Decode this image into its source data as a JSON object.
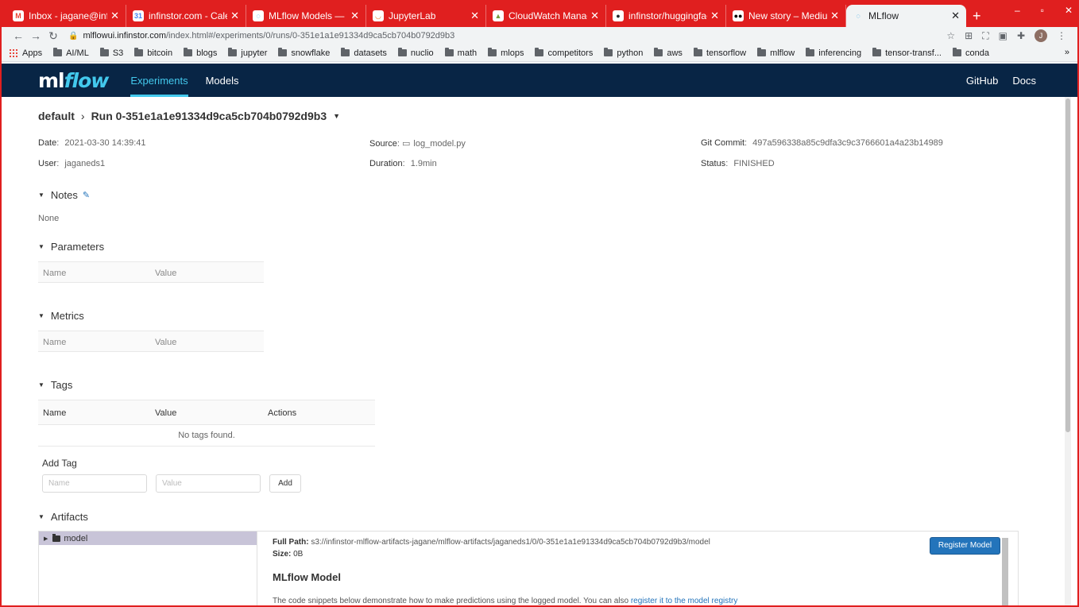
{
  "browser": {
    "tabs": [
      {
        "title": "Inbox - jagane@infinst",
        "icon": "gmail-icon",
        "color": "#ea4335",
        "glyph": "M"
      },
      {
        "title": "infinstor.com - Calendar",
        "icon": "calendar-icon",
        "color": "#4285f4",
        "glyph": "31"
      },
      {
        "title": "MLflow Models — MLflow",
        "icon": "mlflow-icon",
        "color": "#0194e2",
        "glyph": "◌"
      },
      {
        "title": "JupyterLab",
        "icon": "jupyter-icon",
        "color": "#f37726",
        "glyph": "◡"
      },
      {
        "title": "CloudWatch Management",
        "icon": "cloudwatch-icon",
        "color": "#759c3e",
        "glyph": "▲"
      },
      {
        "title": "infinstor/huggingface",
        "icon": "github-icon",
        "color": "#24292e",
        "glyph": "●"
      },
      {
        "title": "New story – Medium",
        "icon": "medium-icon",
        "color": "#000000",
        "glyph": "●●"
      },
      {
        "title": "MLflow",
        "icon": "mlflow-icon",
        "color": "#0194e2",
        "glyph": "◌"
      }
    ],
    "active_tab": 7,
    "url_host": "mlflowui.infinstor.com",
    "url_path": "/index.html#/experiments/0/runs/0-351e1a1e91334d9ca5cb704b0792d9b3",
    "profile_initial": "J",
    "bookmarks": [
      "Apps",
      "AI/ML",
      "S3",
      "bitcoin",
      "blogs",
      "jupyter",
      "snowflake",
      "datasets",
      "nuclio",
      "math",
      "mlops",
      "competitors",
      "python",
      "aws",
      "tensorflow",
      "mlflow",
      "inferencing",
      "tensor-transf...",
      "conda"
    ],
    "bookmarks_more": "»"
  },
  "header": {
    "logo_ml": "ml",
    "logo_flow": "flow",
    "nav": [
      "Experiments",
      "Models"
    ],
    "active_nav": 0,
    "right_links": [
      "GitHub",
      "Docs"
    ]
  },
  "run": {
    "experiment": "default",
    "run_name": "Run 0-351e1a1e91334d9ca5cb704b0792d9b3",
    "meta": {
      "date_label": "Date",
      "date": "2021-03-30 14:39:41",
      "source_label": "Source",
      "source": "log_model.py",
      "git_label": "Git Commit",
      "git": "497a596338a85c9dfa3c9c3766601a4a23b14989",
      "user_label": "User",
      "user": "jaganeds1",
      "duration_label": "Duration",
      "duration": "1.9min",
      "status_label": "Status",
      "status": "FINISHED"
    }
  },
  "sections": {
    "notes": {
      "title": "Notes",
      "value": "None"
    },
    "parameters": {
      "title": "Parameters",
      "cols": [
        "Name",
        "Value"
      ]
    },
    "metrics": {
      "title": "Metrics",
      "cols": [
        "Name",
        "Value"
      ]
    },
    "tags": {
      "title": "Tags",
      "cols": [
        "Name",
        "Value",
        "Actions"
      ],
      "empty": "No tags found."
    },
    "add_tag": {
      "title": "Add Tag",
      "name_placeholder": "Name",
      "value_placeholder": "Value",
      "button": "Add"
    },
    "artifacts": {
      "title": "Artifacts",
      "tree": [
        {
          "name": "model",
          "selected": true
        }
      ],
      "full_path_label": "Full Path:",
      "full_path": "s3://infinstor-mlflow-artifacts-jagane/mlflow-artifacts/jaganeds1/0/0-351e1a1e91334d9ca5cb704b0792d9b3/model",
      "size_label": "Size:",
      "size": "0B",
      "register_button": "Register Model",
      "model_heading": "MLflow Model",
      "desc_text": "The code snippets below demonstrate how to make predictions using the logged model. You can also",
      "desc_link": "register it to the model registry"
    }
  }
}
